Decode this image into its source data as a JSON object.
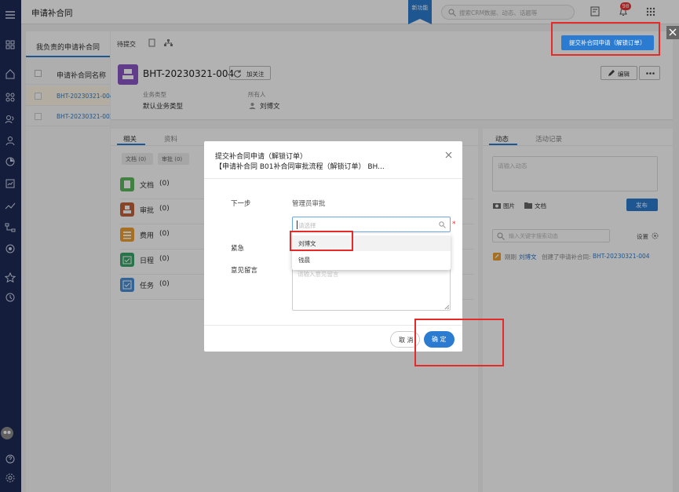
{
  "topbar": {
    "title": "申请补合同",
    "new_feature_badge": "新功能",
    "search_placeholder": "搜索CRM数据、动态、话题等",
    "notification_count": "98"
  },
  "left_panel": {
    "title": "我负责的申请补合同",
    "column_header": "申请补合同名称",
    "rows": [
      "BHT-20230321-004",
      "BHT-20230321-003"
    ]
  },
  "detail": {
    "tab_pending": "待提交",
    "record_title": "BHT-20230321-004",
    "follow_button": "加关注",
    "edit_button": "编辑",
    "submit_button": "提交补合同申请（解锁订单）",
    "business_type_label": "业务类型",
    "business_type_value": "默认业务类型",
    "owner_label": "所有人",
    "owner_value": "刘博文"
  },
  "related": {
    "tabs": [
      "相关",
      "资料"
    ],
    "filter_chips": [
      "文档 (0)",
      "审批 (0)"
    ],
    "items": [
      {
        "label": "文档",
        "count": "(0)",
        "color": "#5cb85c"
      },
      {
        "label": "审批",
        "count": "(0)",
        "color": "#c0643b"
      },
      {
        "label": "费用",
        "count": "(0)",
        "color": "#f0a030"
      },
      {
        "label": "日程",
        "count": "(0)",
        "color": "#3aa66a"
      },
      {
        "label": "任务",
        "count": "(0)",
        "color": "#4a90d9"
      }
    ]
  },
  "dynamic": {
    "tabs": [
      "动态",
      "活动记录"
    ],
    "input_placeholder": "请输入动态",
    "image_label": "图片",
    "doc_label": "文档",
    "publish_button": "发布",
    "search_placeholder": "输入关键字搜索动态",
    "settings_label": "设置",
    "feed_time": "刚刚",
    "feed_user": "刘博文",
    "feed_action": "创建了申请补合同:",
    "feed_link": "BHT-20230321-004"
  },
  "modal": {
    "title": "提交补合同申请（解锁订单）",
    "subtitle": "【申请补合同 B01补合同审批流程（解锁订单） BH...",
    "next_step_label": "下一步",
    "next_step_value": "管理员审批",
    "select_placeholder": "请选择",
    "required_mark": "*",
    "options": [
      "刘博文",
      "钱晨"
    ],
    "urgent_label": "紧急",
    "comment_label": "意见留言",
    "comment_placeholder": "请输入意见留言",
    "cancel_button": "取 消",
    "confirm_button": "确 定"
  },
  "colors": {
    "sidebar": "#1e2c56",
    "primary": "#2b7bd0",
    "highlight": "#e52a2a"
  }
}
